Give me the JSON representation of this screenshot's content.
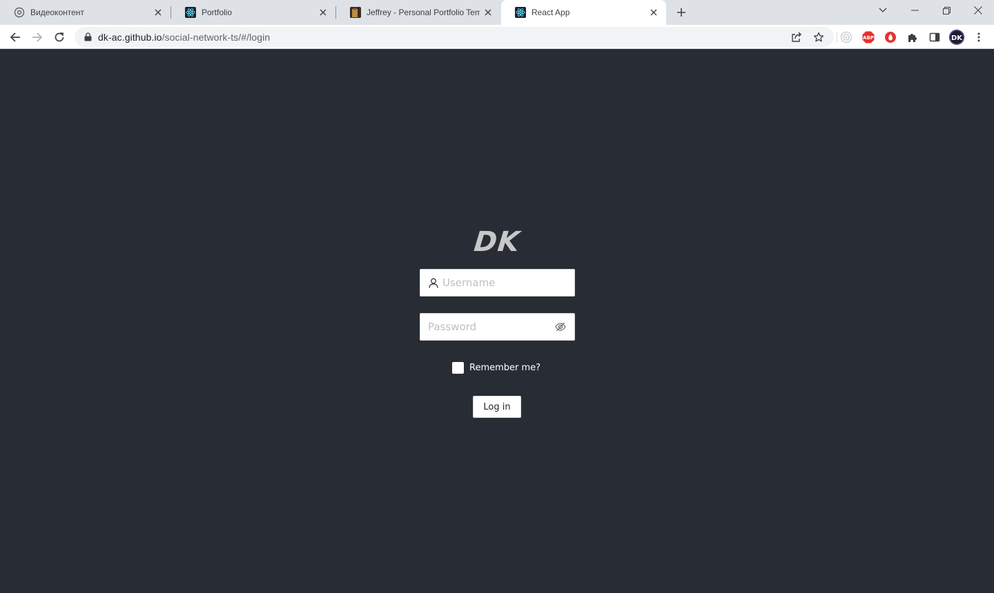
{
  "browser": {
    "tabs": [
      {
        "title": "Видеоконтент",
        "favicon": "gear-badge-icon"
      },
      {
        "title": "Portfolio",
        "favicon": "react-icon"
      },
      {
        "title": "Jeffrey - Personal Portfolio Templ",
        "favicon": "photo-thumbnail-icon"
      },
      {
        "title": "React App",
        "favicon": "react-icon",
        "active": true
      }
    ],
    "url_host": "dk-ac.github.io",
    "url_path": "/social-network-ts/#/login",
    "profile_initials": "DK",
    "extensions": [
      "circle-target-icon",
      "adblock-icon",
      "red-drop-icon",
      "puzzle-icon",
      "side-panel-icon"
    ]
  },
  "login": {
    "logo": "DK",
    "username_placeholder": "Username",
    "password_placeholder": "Password",
    "remember_label": "Remember me?",
    "submit_label": "Log in"
  },
  "colors": {
    "page_background": "#282c34",
    "tabstrip": "#dee1e6",
    "logo_text": "#c7c8ca",
    "adblock_red": "#e8312f"
  }
}
